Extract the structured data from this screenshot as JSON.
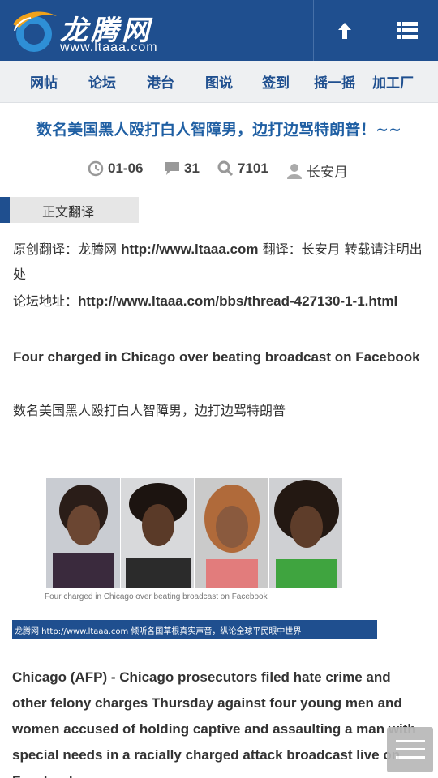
{
  "header": {
    "logo_title": "龙腾网",
    "logo_url": "www.ltaaa.com",
    "colors": {
      "brand": "#1f4f8f",
      "accent": "#f0a21b"
    },
    "buttons": {
      "up_icon": "arrow-up-icon",
      "menu_icon": "list-icon"
    }
  },
  "nav": {
    "items": [
      {
        "label": "网帖"
      },
      {
        "label": "论坛"
      },
      {
        "label": "港台"
      },
      {
        "label": "图说"
      },
      {
        "label": "签到"
      },
      {
        "label": "摇一摇"
      },
      {
        "label": "加工厂"
      }
    ]
  },
  "article": {
    "title": "数名美国黑人殴打白人智障男，边打边骂特朗普！~~",
    "meta": {
      "date": "01-06",
      "comments": "31",
      "views": "7101",
      "author": "长安月"
    },
    "section_tab": "正文翻译",
    "source_prefix": "原创翻译：龙腾网 ",
    "source_url": "http://www.ltaaa.com",
    "source_suffix": " 翻译：长安月 转载请注明出处",
    "forum_prefix": "论坛地址：",
    "forum_url": "http://www.ltaaa.com/bbs/thread-427130-1-1.html",
    "headline_en": "Four charged in Chicago over beating broadcast on Facebook",
    "headline_cn": "数名美国黑人殴打白人智障男，边打边骂特朗普",
    "image_caption": "Four charged in Chicago over beating broadcast on Facebook",
    "image_watermark": "龙腾网 http://www.ltaaa.com 倾听各国草根真实声音，纵论全球平民眼中世界",
    "body_en": "Chicago (AFP) - Chicago prosecutors filed hate crime and other felony charges Thursday against four young men and women accused of holding captive and assaulting a man with special needs in a racially charged attack broadcast live on Facebook"
  },
  "floating": {
    "menu_icon": "hamburger-icon"
  }
}
